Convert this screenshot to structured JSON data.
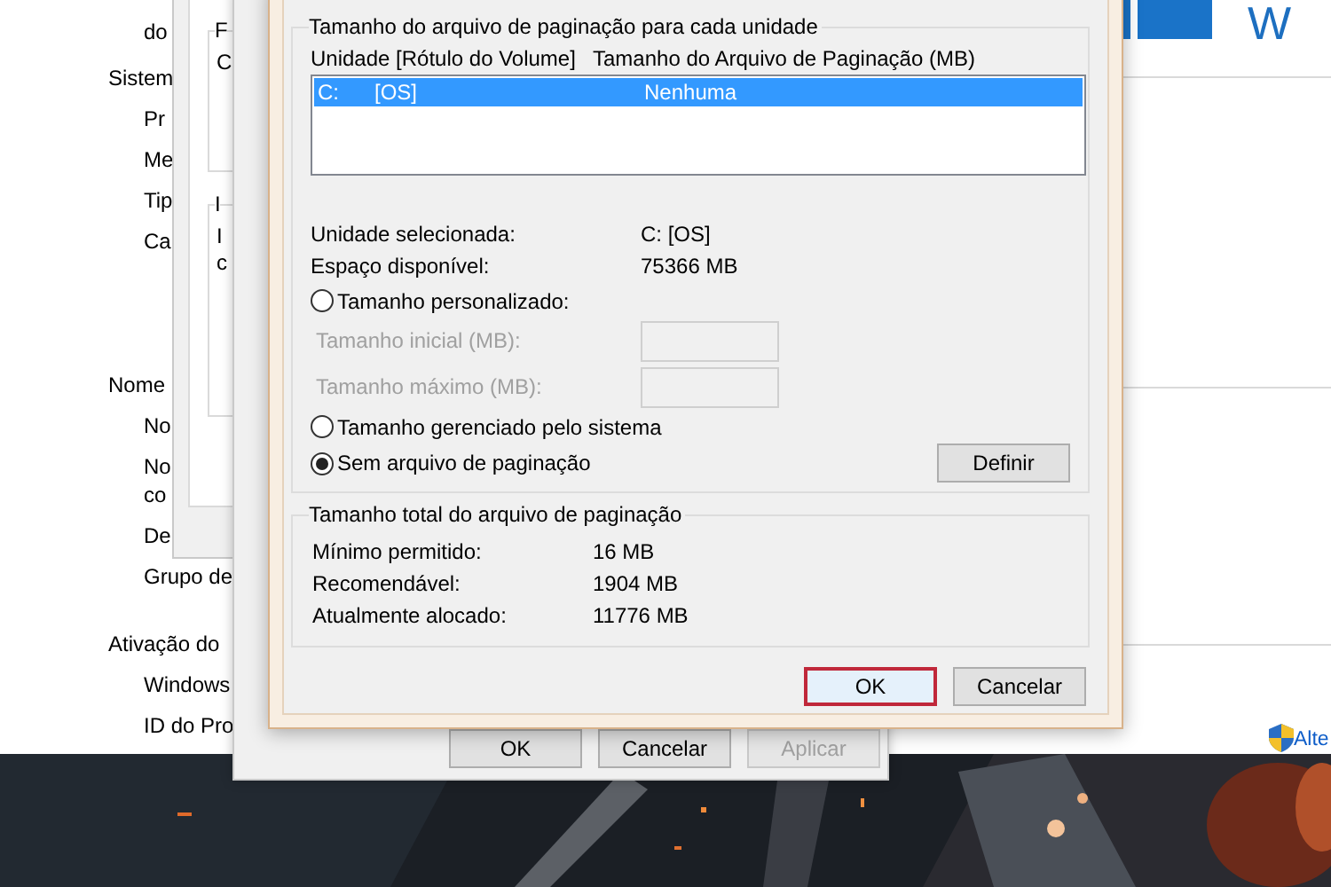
{
  "system_window": {
    "sections": [
      {
        "items": [
          {
            "lines": [
              "do"
            ]
          }
        ]
      },
      {
        "heading": "Sistem",
        "items": [
          {
            "lines": [
              "Pr"
            ]
          },
          {
            "lines": [
              "Me"
            ]
          },
          {
            "lines": [
              "Tip"
            ]
          },
          {
            "lines": [
              "Ca"
            ]
          }
        ]
      },
      {
        "heading": "Nome",
        "items": [
          {
            "lines": [
              "No"
            ]
          },
          {
            "lines": [
              "No",
              "co"
            ]
          },
          {
            "lines": [
              "De"
            ]
          },
          {
            "lines": [
              "Grupo de"
            ]
          }
        ]
      },
      {
        "heading": "Ativação do",
        "items": [
          {
            "lines": [
              "Windows"
            ]
          },
          {
            "lines": [
              "ID do Pro"
            ]
          }
        ]
      }
    ],
    "logo_text": "W",
    "link": "Alte"
  },
  "back_window": {
    "groups": [
      {
        "legend": "F",
        "lines": [
          "C"
        ]
      },
      {
        "legend": "I",
        "lines": [
          "I",
          "c"
        ]
      }
    ]
  },
  "performance_window": {
    "buttons": [
      {
        "label": "OK",
        "disabled": false
      },
      {
        "label": "Cancelar",
        "disabled": false
      },
      {
        "label": "Aplicar",
        "disabled": true
      }
    ]
  },
  "virtual_memory_dialog": {
    "drives_group": {
      "legend": "Tamanho do arquivo de paginação para cada unidade",
      "columns": [
        "Unidade [Rótulo do Volume]",
        "Tamanho do Arquivo de Paginação (MB)"
      ],
      "rows": [
        {
          "drive": "C:",
          "label": "[OS]",
          "size": "Nenhuma",
          "selected": true
        }
      ],
      "info": [
        {
          "label": "Unidade selecionada:",
          "value": "C:  [OS]"
        },
        {
          "label": "Espaço disponível:",
          "value": "75366 MB"
        }
      ],
      "options": [
        {
          "kind": "radio",
          "label": "Tamanho personalizado:",
          "selected": false
        },
        {
          "kind": "field",
          "label": "Tamanho inicial (MB):",
          "disabled": true
        },
        {
          "kind": "field",
          "label": "Tamanho máximo (MB):",
          "disabled": true
        },
        {
          "kind": "radio",
          "label": "Tamanho gerenciado pelo sistema",
          "selected": false
        },
        {
          "kind": "radio",
          "label": "Sem arquivo de paginação",
          "selected": true
        }
      ],
      "set_button": "Definir"
    },
    "total_group": {
      "legend": "Tamanho total do arquivo de paginação",
      "rows": [
        {
          "label": "Mínimo permitido:",
          "value": "16 MB"
        },
        {
          "label": "Recomendável:",
          "value": "1904 MB"
        },
        {
          "label": "Atualmente alocado:",
          "value": "11776 MB"
        }
      ]
    },
    "buttons": [
      {
        "label": "OK",
        "focused": true
      },
      {
        "label": "Cancelar",
        "focused": false
      }
    ]
  }
}
